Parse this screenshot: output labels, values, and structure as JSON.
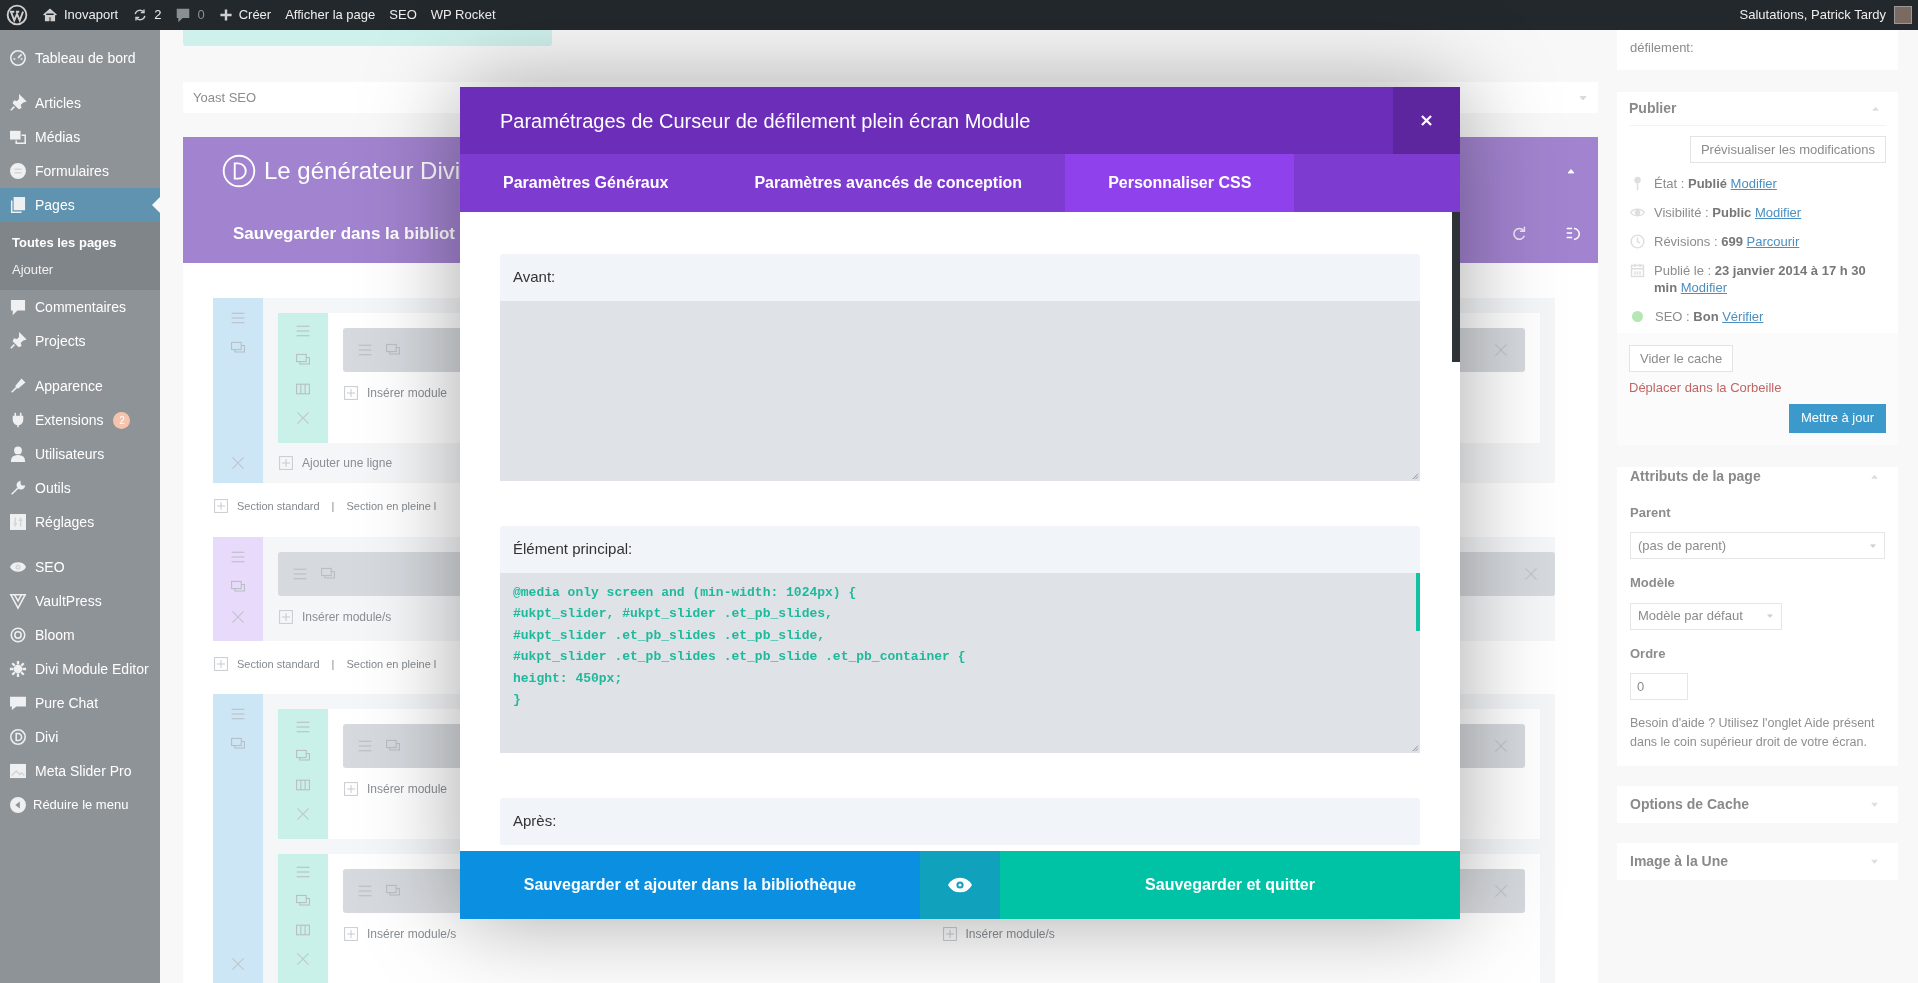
{
  "admin_bar": {
    "items": [
      {
        "kind": "logo"
      },
      {
        "kind": "site",
        "label": "Inovaport"
      },
      {
        "kind": "updates",
        "label": "2"
      },
      {
        "kind": "comments",
        "label": "0"
      },
      {
        "kind": "new",
        "label": "Créer"
      },
      {
        "kind": "link",
        "label": "Afficher la page"
      },
      {
        "kind": "link",
        "label": "SEO"
      },
      {
        "kind": "link",
        "label": "WP Rocket"
      }
    ],
    "greeting": "Salutations, Patrick Tardy"
  },
  "sidebar": {
    "groups": [
      {
        "items": [
          {
            "label": "Tableau de bord",
            "selected": false
          }
        ]
      },
      {
        "items": [
          {
            "label": "Articles",
            "selected": false
          },
          {
            "label": "Médias",
            "selected": false
          },
          {
            "label": "Formulaires",
            "selected": false
          },
          {
            "label": "Pages",
            "selected": true,
            "children": [
              {
                "label": "Toutes les pages",
                "selected": true
              },
              {
                "label": "Ajouter",
                "selected": false
              }
            ]
          },
          {
            "label": "Commentaires",
            "selected": false
          },
          {
            "label": "Projects",
            "selected": false
          }
        ]
      },
      {
        "items": [
          {
            "label": "Apparence",
            "selected": false
          },
          {
            "label": "Extensions",
            "selected": false,
            "badge": "2"
          },
          {
            "label": "Utilisateurs",
            "selected": false
          },
          {
            "label": "Outils",
            "selected": false
          },
          {
            "label": "Réglages",
            "selected": false
          }
        ]
      },
      {
        "items": [
          {
            "label": "SEO",
            "selected": false
          },
          {
            "label": "VaultPress",
            "selected": false
          },
          {
            "label": "Bloom",
            "selected": false
          },
          {
            "label": "Divi Module Editor",
            "selected": false
          },
          {
            "label": "Pure Chat",
            "selected": false
          },
          {
            "label": "Divi",
            "selected": false
          },
          {
            "label": "Meta Slider Pro",
            "selected": false
          }
        ]
      }
    ],
    "collapse": "Réduire le menu"
  },
  "yoast_box": {
    "title": "Yoast SEO"
  },
  "builder": {
    "title": "Le générateur Divi",
    "save_label": "Sauvegarder dans la bibliot",
    "sections": [
      {
        "kind": "standard",
        "color": "#cde6f6",
        "rows": [
          {
            "columns": [
              "Insérer module"
            ]
          }
        ],
        "add_row": "Ajouter une ligne",
        "links": [
          "Section standard",
          "|",
          "Section en pleine l"
        ]
      },
      {
        "kind": "specialty",
        "color": "#e8dafa",
        "insert": "Insérer module/s",
        "links": [
          "Section standard",
          "|",
          "Section en pleine l"
        ]
      },
      {
        "kind": "standard",
        "color": "#cde6f6",
        "rows": [
          {
            "columns": [
              "Insérer module"
            ]
          },
          {
            "columns": [
              "Insérer module/s",
              "Insérer module/s"
            ]
          }
        ]
      }
    ]
  },
  "right_panel": {
    "nav_box": {
      "label": "défilement:"
    },
    "publish": {
      "title": "Publier",
      "preview": "Prévisualiser les modifications",
      "rows": [
        {
          "text": "État : **Publié**",
          "link": "Modifier"
        },
        {
          "text": "Visibilité : **Public**",
          "link": "Modifier"
        },
        {
          "text": "Révisions : **699**",
          "link": "Parcourir"
        },
        {
          "text": "Publié le : **23 janvier 2014 à 17 h 30 min**",
          "link": "Modifier"
        },
        {
          "text": "SEO : **Bon**",
          "link": "Vérifier"
        }
      ],
      "clear_cache": "Vider le cache",
      "trash": "Déplacer dans la Corbeille",
      "update": "Mettre à jour"
    },
    "attributes": {
      "title": "Attributs de la page",
      "parent_label": "Parent",
      "parent_value": "(pas de parent)",
      "template_label": "Modèle",
      "template_value": "Modèle par défaut",
      "order_label": "Ordre",
      "order_value": "0",
      "help": "Besoin d'aide ? Utilisez l'onglet Aide présent dans le coin supérieur droit de votre écran."
    },
    "collapsed_boxes": [
      {
        "title": "Options de Cache"
      },
      {
        "title": "Image à la Une"
      }
    ]
  },
  "modal": {
    "title": "Paramétrages de Curseur de défilement plein écran Module",
    "tabs": [
      {
        "label": "Paramètres Généraux",
        "selected": false
      },
      {
        "label": "Paramètres avancés de conception",
        "selected": false
      },
      {
        "label": "Personnaliser CSS",
        "selected": true
      }
    ],
    "fields": [
      {
        "label": "Avant:"
      },
      {
        "label": "Élément principal:",
        "code": [
          "@media only screen and (min-width: 1024px) {",
          "#ukpt_slider, #ukpt_slider .et_pb_slides,",
          "#ukpt_slider .et_pb_slides .et_pb_slide,",
          "#ukpt_slider .et_pb_slides .et_pb_slide .et_pb_container {",
          "height: 450px;",
          "}"
        ]
      },
      {
        "label": "Après:"
      }
    ],
    "save_library": "Sauvegarder et ajouter dans la bibliothèque",
    "save_exit": "Sauvegarder et quitter"
  }
}
